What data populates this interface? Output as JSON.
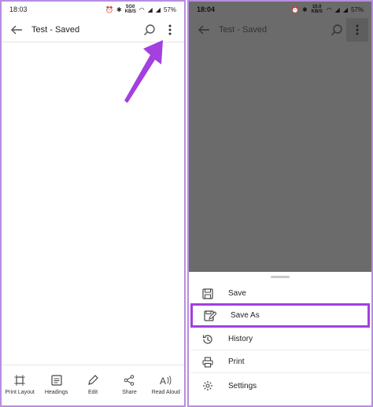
{
  "left": {
    "status": {
      "time": "18:03",
      "network": "5G0 KB/S",
      "battery": "57%"
    },
    "app_bar": {
      "title": "Test - Saved"
    },
    "toolbar": [
      {
        "label": "Print Layout",
        "icon": "print-layout-icon"
      },
      {
        "label": "Headings",
        "icon": "headings-icon"
      },
      {
        "label": "Edit",
        "icon": "pencil-icon"
      },
      {
        "label": "Share",
        "icon": "share-icon"
      },
      {
        "label": "Read Aloud",
        "icon": "read-aloud-icon"
      }
    ]
  },
  "right": {
    "status": {
      "time": "18:04",
      "network": "10.0 KB/S",
      "battery": "57%"
    },
    "app_bar": {
      "title": "Test - Saved"
    },
    "menu": [
      {
        "label": "Save",
        "icon": "save-icon"
      },
      {
        "label": "Save As",
        "icon": "save-as-icon",
        "highlighted": true
      },
      {
        "label": "History",
        "icon": "history-icon"
      },
      {
        "label": "Print",
        "icon": "printer-icon"
      },
      {
        "label": "Settings",
        "icon": "gear-icon"
      }
    ]
  },
  "colors": {
    "highlight": "#a43fe0",
    "arrow": "#a43fe0",
    "overlay": "#6b6b6b"
  }
}
